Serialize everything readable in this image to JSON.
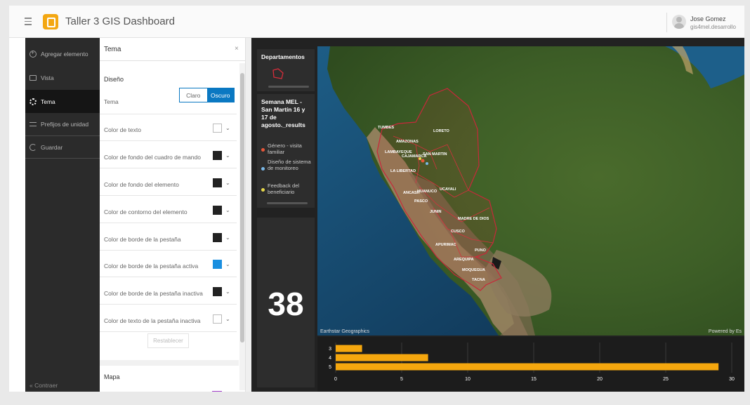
{
  "header": {
    "app_title": "Taller 3 GIS Dashboard",
    "user_name": "Jose Gomez",
    "user_handle": "gis4mel.desarrollo"
  },
  "nav": {
    "items": [
      {
        "label": "Agregar elemento",
        "icon": "plus-circle-icon"
      },
      {
        "label": "Vista",
        "icon": "view-icon"
      },
      {
        "label": "Tema",
        "icon": "gear-icon",
        "active": true
      },
      {
        "label": "Prefijos de unidad",
        "icon": "units-icon"
      },
      {
        "label": "Guardar",
        "icon": "save-icon"
      }
    ],
    "collapse_label": "Contraer"
  },
  "panel": {
    "title": "Tema",
    "section_design": "Diseño",
    "theme_label": "Tema",
    "theme_options": [
      "Claro",
      "Oscuro"
    ],
    "theme_selected": "Oscuro",
    "rows": [
      {
        "label": "Color de texto",
        "color": "#ffffff"
      },
      {
        "label": "Color de fondo del cuadro de mando",
        "color": "#222222"
      },
      {
        "label": "Color de fondo del elemento",
        "color": "#222222"
      },
      {
        "label": "Color de contorno del elemento",
        "color": "#222222"
      },
      {
        "label": "Color de borde de la pestaña",
        "color": "#222222"
      },
      {
        "label": "Color de borde de la pestaña activa",
        "color": "#1a8fe0"
      },
      {
        "label": "Color de borde de la pestaña inactiva",
        "color": "#222222"
      },
      {
        "label": "Color de texto de la pestaña inactiva",
        "color": "#ffffff"
      }
    ],
    "reset_label": "Restablecer",
    "section_map": "Mapa"
  },
  "dashboard": {
    "departments_title": "Departamentos",
    "legend_title": "Semana MEL - San Martín 16 y 17 de agosto._results",
    "legend_items": [
      {
        "label": "Género - visita familiar",
        "color": "#e8573a"
      },
      {
        "label": "Diseño de sistema de monitoreo",
        "color": "#7ab8e8"
      },
      {
        "label": "Feedback del beneficiario",
        "color": "#e8d84a"
      }
    ],
    "indicator_value": "38",
    "map": {
      "attribution_left": "Earthstar Geographics",
      "attribution_right": "Powered by Es",
      "labels": [
        "TUMBES",
        "AMAZONAS",
        "LORETO",
        "LAMBAYEQUE",
        "CAJAMARCA",
        "SAN MARTIN",
        "LA LIBERTAD",
        "ANCASH",
        "HUANUCO",
        "PASCO",
        "JUNIN",
        "UCAYALI",
        "MADRE DE DIOS",
        "CUSCO",
        "APURIMAC",
        "PUNO",
        "AREQUIPA",
        "MOQUEGUA",
        "TACNA"
      ]
    }
  },
  "chart_data": {
    "type": "bar",
    "orientation": "horizontal",
    "categories": [
      "3",
      "4",
      "5"
    ],
    "values": [
      2,
      7,
      29
    ],
    "xlim": [
      0,
      30
    ],
    "xticks": [
      0,
      5,
      10,
      15,
      20,
      25,
      30
    ],
    "color": "#f5a70e",
    "grid": true
  }
}
